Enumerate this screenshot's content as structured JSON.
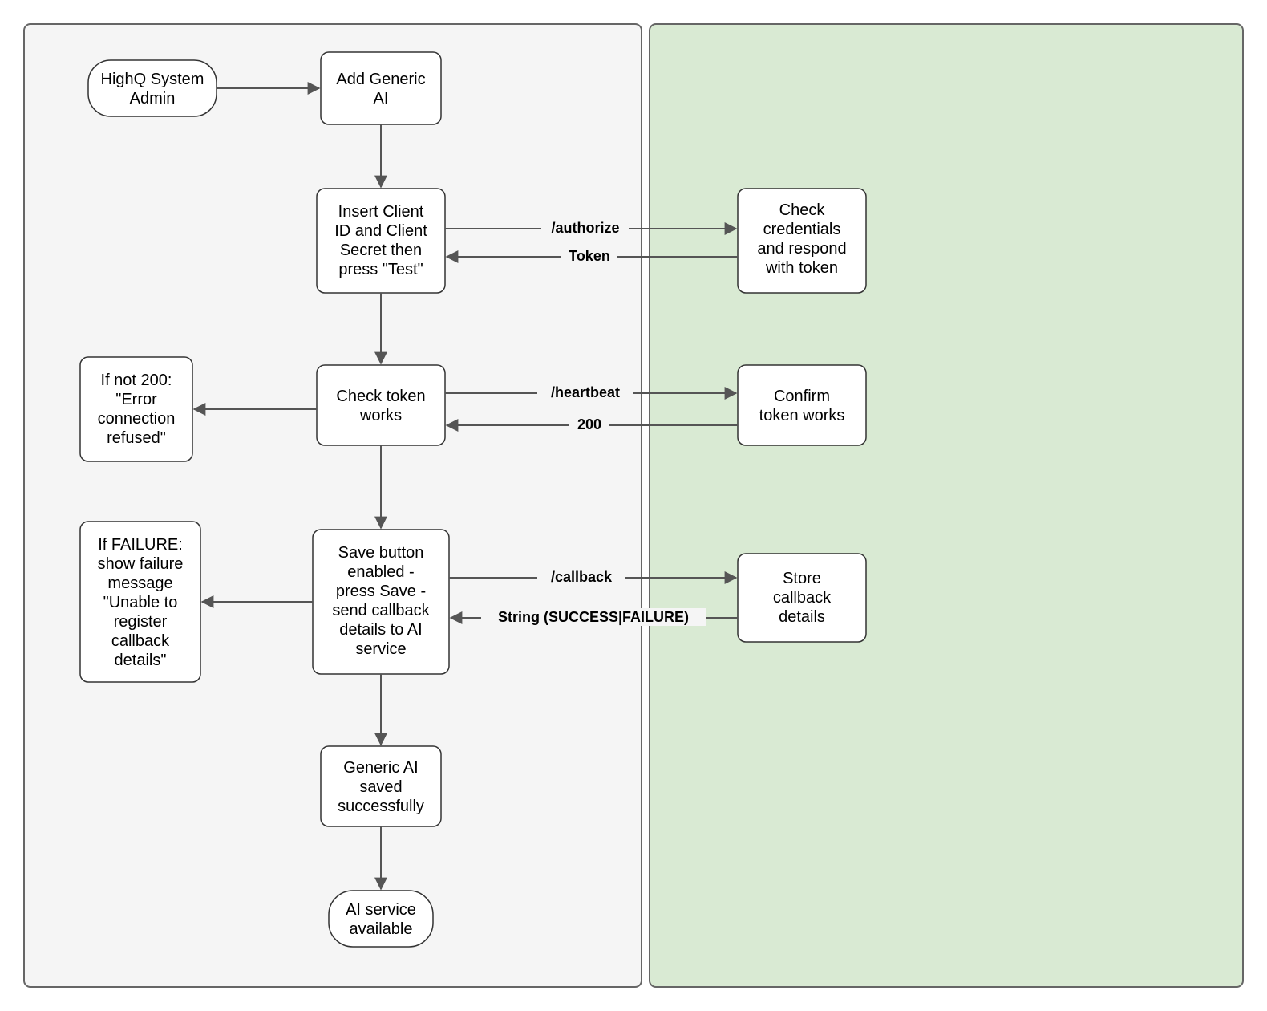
{
  "diagram": {
    "swimlanes": {
      "left": {
        "color": "#f5f5f5"
      },
      "right": {
        "color": "#d9ead3"
      }
    },
    "nodes": {
      "admin": {
        "lines": [
          "HighQ System",
          "Admin"
        ]
      },
      "addGeneric": {
        "lines": [
          "Add Generic",
          "AI"
        ]
      },
      "insertClient": {
        "lines": [
          "Insert Client",
          "ID and Client",
          "Secret then",
          "press \"Test\""
        ]
      },
      "checkToken": {
        "lines": [
          "Check token",
          "works"
        ]
      },
      "ifNot200": {
        "lines": [
          "If not 200:",
          "\"Error",
          "connection",
          "refused\""
        ]
      },
      "saveButton": {
        "lines": [
          "Save button",
          "enabled -",
          "press Save -",
          "send callback",
          "details to AI",
          "service"
        ]
      },
      "ifFailure": {
        "lines": [
          "If FAILURE:",
          "show failure",
          "message",
          "\"Unable to",
          "register",
          "callback",
          "details\""
        ]
      },
      "savedOk": {
        "lines": [
          "Generic AI",
          "saved",
          "successfully"
        ]
      },
      "aiAvailable": {
        "lines": [
          "AI service",
          "available"
        ]
      },
      "checkCreds": {
        "lines": [
          "Check",
          "credentials",
          "and respond",
          "with token"
        ]
      },
      "confirmToken": {
        "lines": [
          "Confirm",
          "token works"
        ]
      },
      "storeCallback": {
        "lines": [
          "Store",
          "callback",
          "details"
        ]
      }
    },
    "edges": {
      "authorize": "/authorize",
      "token": "Token",
      "heartbeat": "/heartbeat",
      "two_hundred": "200",
      "callback": "/callback",
      "successFailure": "String (SUCCESS|FAILURE)"
    }
  }
}
